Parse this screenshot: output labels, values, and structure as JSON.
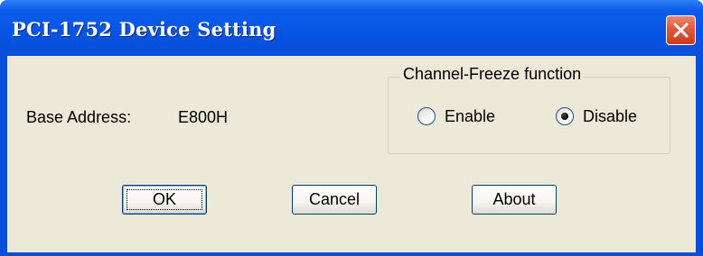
{
  "window": {
    "title": "PCI-1752 Device Setting",
    "close_icon": "close-icon",
    "title_bar_color": "#0a4fd8",
    "client_color": "#ece9d8",
    "close_color": "#e0583a"
  },
  "base_address": {
    "label": "Base Address:",
    "value": "E800H"
  },
  "channel_freeze": {
    "legend": "Channel-Freeze function",
    "options": [
      {
        "label": "Enable",
        "selected": false
      },
      {
        "label": "Disable",
        "selected": true
      }
    ]
  },
  "buttons": {
    "ok": "OK",
    "cancel": "Cancel",
    "about": "About"
  }
}
